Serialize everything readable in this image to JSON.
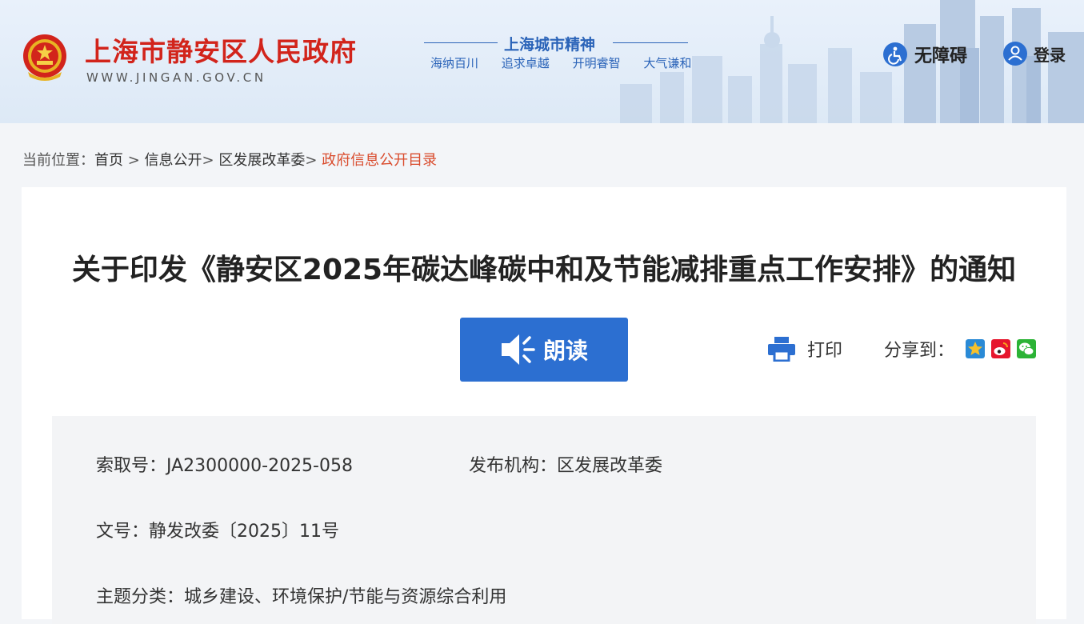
{
  "header": {
    "site_name": "上海市静安区人民政府",
    "site_url": "WWW.JINGAN.GOV.CN",
    "spirit_title": "上海城市精神",
    "spirit_words": [
      "海纳百川",
      "追求卓越",
      "开明睿智",
      "大气谦和"
    ],
    "accessibility_label": "无障碍",
    "login_label": "登录"
  },
  "breadcrumb": {
    "prefix": "当前位置：",
    "items": [
      "首页",
      "信息公开",
      "区发展改革委"
    ],
    "separators": [
      " > ",
      "> ",
      "> "
    ],
    "current": "政府信息公开目录"
  },
  "article": {
    "title": "关于印发《静安区2025年碳达峰碳中和及节能减排重点工作安排》的通知",
    "read_label": "朗读",
    "print_label": "打印",
    "share_label": "分享到："
  },
  "meta": {
    "index_no": "索取号：JA2300000-2025-058",
    "publisher": "发布机构：区发展改革委",
    "doc_no": "文号：静发改委〔2025〕11号",
    "topic": "主题分类：城乡建设、环境保护/节能与资源综合利用"
  },
  "colors": {
    "accent_blue": "#2c6fd1",
    "site_red": "#d2241b",
    "breadcrumb_current": "#d94b2c"
  },
  "icons": [
    "national-emblem-icon",
    "wheelchair-icon",
    "user-icon",
    "speaker-icon",
    "printer-icon",
    "qzone-icon",
    "weibo-icon",
    "wechat-icon"
  ]
}
